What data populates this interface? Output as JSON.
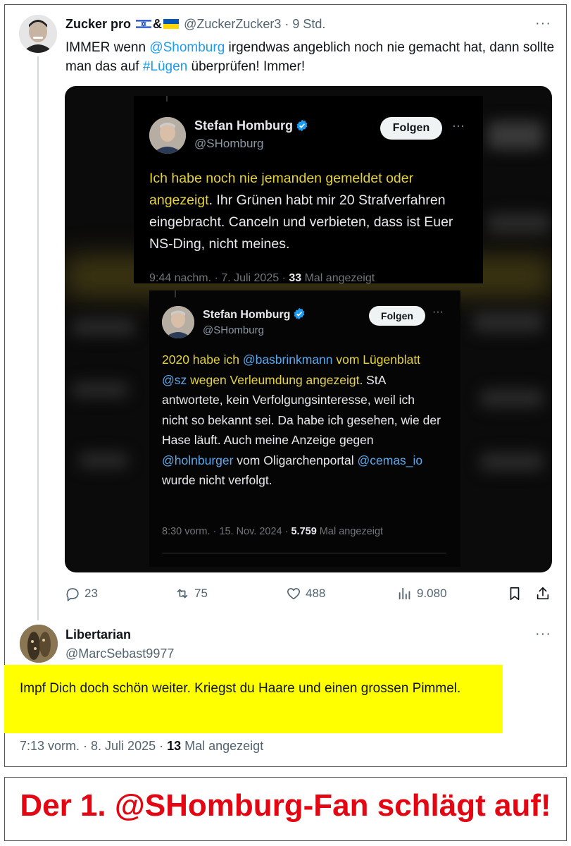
{
  "tweet": {
    "author_name": "Zucker pro",
    "name_suffix": "&",
    "handle": "@ZuckerZucker3",
    "separator": "·",
    "time": "9 Std.",
    "more": "···",
    "text_parts": [
      "IMMER wenn ",
      "@Shomburg",
      " irgendwas angeblich noch nie gemacht hat, dann sollte man das auf ",
      "#Lügen",
      " überprüfen! Immer!"
    ]
  },
  "embedded": {
    "card1": {
      "name": "Stefan Homburg",
      "handle": "@SHomburg",
      "follow": "Folgen",
      "more": "···",
      "text_highlight": "Ich habe noch nie jemanden gemeldet oder angezeigt",
      "text_rest": ". Ihr Grünen habt mir 20 Strafverfahren eingebracht. Canceln und verbieten, dass ist Euer NS-Ding, nicht meines.",
      "meta_time": "9:44 nachm. · 7. Juli 2025 · ",
      "meta_views": "33",
      "meta_suffix": " Mal angezeigt"
    },
    "card2": {
      "name": "Stefan Homburg",
      "handle": "@SHomburg",
      "follow": "Folgen",
      "more": "···",
      "t1": "2020 habe ich ",
      "m1": "@basbrinkmann",
      "t2": " vom Lügenblatt ",
      "m2": "@sz",
      "t3": " wegen Verleumdung angezeigt.",
      "t4": " StA antwortete, kein Verfolgungsinteresse, weil ich nicht so bekannt sei. Da habe ich gesehen, wie der Hase läuft. Auch meine Anzeige gegen ",
      "m3": "@holnburger",
      "t5": " vom Oligarchenportal ",
      "m4": "@cemas_io",
      "t6": " wurde nicht verfolgt.",
      "meta_time": "8:30 vorm. · 15. Nov. 2024 · ",
      "meta_views": "5.759",
      "meta_suffix": " Mal angezeigt"
    }
  },
  "actions": {
    "replies": "23",
    "retweets": "75",
    "likes": "488",
    "views": "9.080"
  },
  "reply": {
    "author_name": "Libertarian",
    "handle": "@MarcSebast9977",
    "more": "···",
    "text": "Impf Dich doch schön weiter. Kriegst du Haare und einen grossen Pimmel.",
    "meta_time": "7:13 vorm. · 8. Juli 2025 · ",
    "meta_views": "13",
    "meta_suffix": " Mal angezeigt"
  },
  "caption": "Der 1. @SHomburg-Fan schlägt auf!",
  "colors": {
    "link": "#1d9bf0",
    "highlight": "#ffff00",
    "caption": "#e30613",
    "quoted_highlight": "#e5d33a"
  }
}
